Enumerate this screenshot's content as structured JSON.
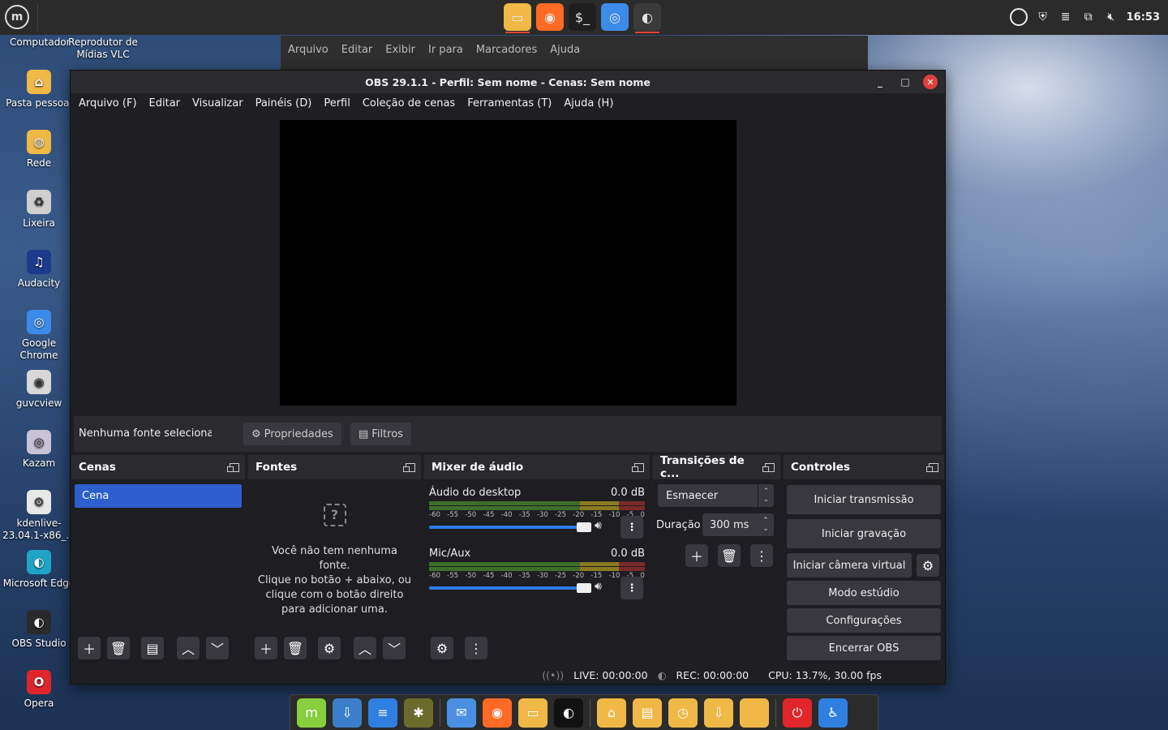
{
  "top_panel": {
    "clock": "16:53",
    "taskbar": [
      {
        "name": "files",
        "color": "#f0b847",
        "glyph": "▭",
        "active": true
      },
      {
        "name": "firefox",
        "color": "#ff6a24",
        "glyph": "◉",
        "active": false
      },
      {
        "name": "terminal",
        "color": "#1e1e1e",
        "glyph": "$_",
        "active": false
      },
      {
        "name": "chrome",
        "color": "#3d8be8",
        "glyph": "◎",
        "active": false
      },
      {
        "name": "obs",
        "color": "#3a3a3a",
        "glyph": "◐",
        "active": true
      }
    ]
  },
  "desktop": {
    "top_labels": [
      "Computador",
      "Reprodutor de\nMídias VLC"
    ],
    "items": [
      {
        "label": "Pasta pessoal",
        "icon": "home-folder-icon",
        "color": "#f0b847",
        "glyph": "⌂"
      },
      {
        "label": "Rede",
        "icon": "network-folder-icon",
        "color": "#f0b847",
        "glyph": "◍"
      },
      {
        "label": "Lixeira",
        "icon": "trash-icon",
        "color": "#cfcfcf",
        "glyph": "♻"
      },
      {
        "label": "Audacity",
        "icon": "audacity-icon",
        "color": "#1d3b8c",
        "glyph": "♫"
      },
      {
        "label": "Google\nChrome",
        "icon": "chrome-icon",
        "color": "#3d8be8",
        "glyph": "◎"
      },
      {
        "label": "guvcview",
        "icon": "webcam-icon",
        "color": "#d8d8d8",
        "glyph": "◉"
      },
      {
        "label": "Kazam",
        "icon": "kazam-icon",
        "color": "#c9c3d6",
        "glyph": "◎"
      },
      {
        "label": "kdenlive-\n23.04.1-x86_...",
        "icon": "kdenlive-icon",
        "color": "#e8e8e8",
        "glyph": "⚙"
      },
      {
        "label": "Microsoft Edge",
        "icon": "edge-icon",
        "color": "#1fa4c8",
        "glyph": "◐"
      },
      {
        "label": "OBS Studio",
        "icon": "obs-icon",
        "color": "#2a2a2a",
        "glyph": "◐"
      },
      {
        "label": "Opera",
        "icon": "opera-icon",
        "color": "#e0262a",
        "glyph": "O"
      }
    ]
  },
  "bg_window": {
    "menu": [
      "Arquivo",
      "Editar",
      "Exibir",
      "Ir para",
      "Marcadores",
      "Ajuda"
    ]
  },
  "obs": {
    "title": "OBS 29.1.1 - Perfil: Sem nome - Cenas: Sem nome",
    "menu": [
      "Arquivo (F)",
      "Editar",
      "Visualizar",
      "Painéis (D)",
      "Perfil",
      "Coleção de cenas",
      "Ferramentas (T)",
      "Ajuda (H)"
    ],
    "source_bar": {
      "no_source": "Nenhuma fonte selecionada",
      "properties": "Propriedades",
      "filters": "Filtros"
    },
    "scenes": {
      "title": "Cenas",
      "items": [
        "Cena"
      ]
    },
    "sources": {
      "title": "Fontes",
      "empty_line1": "Você não tem nenhuma",
      "empty_line2": "fonte.",
      "empty_line3": "Clique no botão + abaixo, ou",
      "empty_line4": "clique com o botão direito",
      "empty_line5": "para adicionar uma."
    },
    "mixer": {
      "title": "Mixer de áudio",
      "scale": [
        "-60",
        "-55",
        "-50",
        "-45",
        "-40",
        "-35",
        "-30",
        "-25",
        "-20",
        "-15",
        "-10",
        "-5",
        "0"
      ],
      "channels": [
        {
          "name": "Áudio do desktop",
          "db": "0.0 dB",
          "volume": 1.0
        },
        {
          "name": "Mic/Aux",
          "db": "0.0 dB",
          "volume": 1.0
        }
      ]
    },
    "transitions": {
      "title": "Transições de c...",
      "selected": "Esmaecer",
      "duration_label": "Duração",
      "duration_value": "300 ms"
    },
    "controls": {
      "title": "Controles",
      "start_stream": "Iniciar transmissão",
      "start_record": "Iniciar gravação",
      "start_virtualcam": "Iniciar câmera virtual",
      "studio_mode": "Modo estúdio",
      "settings": "Configurações",
      "exit": "Encerrar OBS"
    },
    "status": {
      "live": "LIVE: 00:00:00",
      "rec": "REC: 00:00:00",
      "cpu": "CPU: 13.7%, 30.00 fps"
    }
  },
  "bottom_dock": [
    {
      "name": "mint-menu",
      "color": "#87cf3e",
      "glyph": "m"
    },
    {
      "name": "update-manager",
      "color": "#3b7dc9",
      "glyph": "⇩"
    },
    {
      "name": "text-editor",
      "color": "#2f7fe0",
      "glyph": "≡"
    },
    {
      "name": "image-viewer",
      "color": "#6b6b2b",
      "glyph": "✱"
    },
    {
      "name": "mail",
      "color": "#4a8fe2",
      "glyph": "✉"
    },
    {
      "name": "firefox",
      "color": "#ff6a24",
      "glyph": "◉"
    },
    {
      "name": "text-editor-2",
      "color": "#f0b847",
      "glyph": "▭"
    },
    {
      "name": "obs",
      "color": "#111111",
      "glyph": "◐"
    },
    {
      "name": "home-folder",
      "color": "#f0b847",
      "glyph": "⌂"
    },
    {
      "name": "documents-folder",
      "color": "#f0b847",
      "glyph": "▤"
    },
    {
      "name": "recent-folder",
      "color": "#f0b847",
      "glyph": "◷"
    },
    {
      "name": "downloads-folder",
      "color": "#f0b847",
      "glyph": "⇩"
    },
    {
      "name": "folder",
      "color": "#f0b847",
      "glyph": ""
    },
    {
      "name": "power",
      "color": "#e0262a",
      "glyph": "⏻"
    },
    {
      "name": "accessibility",
      "color": "#2f7fe0",
      "glyph": "♿"
    }
  ]
}
